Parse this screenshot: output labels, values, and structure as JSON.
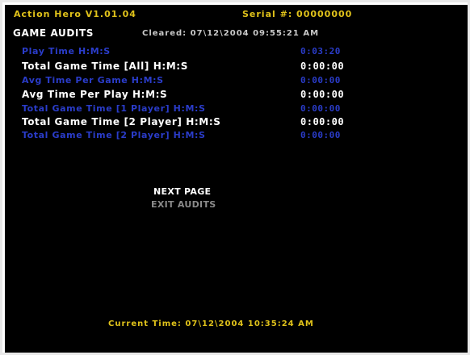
{
  "header": {
    "game_version": "Action Hero V1.01.04",
    "serial": "Serial #: 00000000",
    "title": "GAME AUDITS",
    "cleared": "Cleared: 07\\12\\2004 09:55:21 AM"
  },
  "audits": [
    {
      "label": "Play Time H:M:S",
      "value": "0:03:20",
      "color": "blue"
    },
    {
      "label": "Total Game Time [All] H:M:S",
      "value": "0:00:00",
      "color": "white"
    },
    {
      "label": "Avg Time Per Game H:M:S",
      "value": "0:00:00",
      "color": "blue"
    },
    {
      "label": "Avg Time Per Play H:M:S",
      "value": "0:00:00",
      "color": "white"
    },
    {
      "label": "Total Game Time [1 Player] H:M:S",
      "value": "0:00:00",
      "color": "blue"
    },
    {
      "label": "Total Game Time [2 Player] H:M:S",
      "value": "0:00:00",
      "color": "white"
    },
    {
      "label": "Total Game Time [2 Player] H:M:S",
      "value": "0:00:00",
      "color": "blue"
    }
  ],
  "menu": {
    "next_page": "NEXT PAGE",
    "exit_audits": "EXIT AUDITS"
  },
  "footer": {
    "current_time": "Current Time: 07\\12\\2004 10:35:24 AM"
  },
  "colors": {
    "background": "#000000",
    "header_yellow": "#e0c21a",
    "row_white": "#ffffff",
    "row_blue": "#2a3cc9",
    "menu_dim": "#8a8a8a"
  }
}
